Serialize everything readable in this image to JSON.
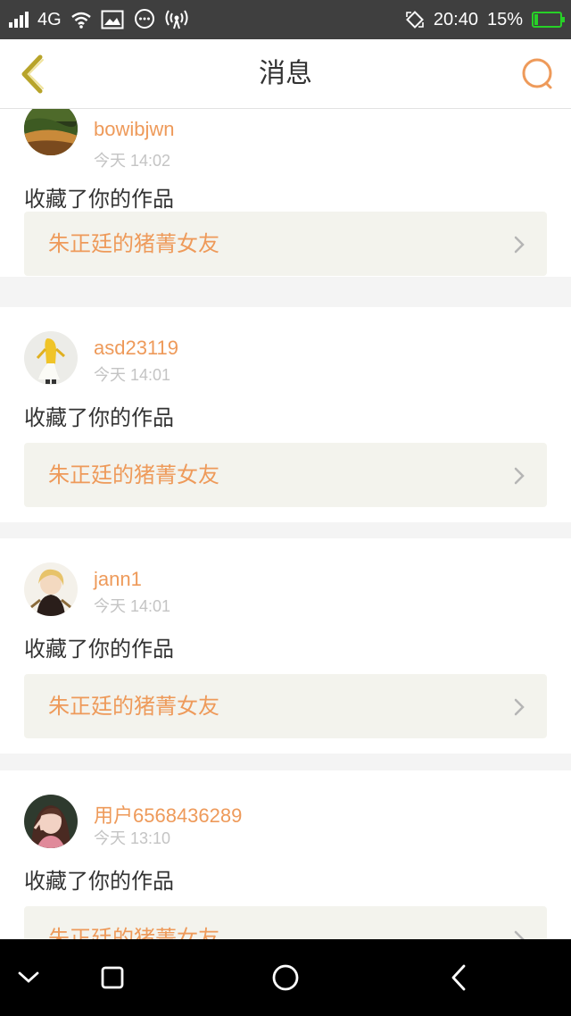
{
  "status_bar": {
    "network": "4G",
    "time": "20:40",
    "battery_percent": "15%",
    "battery_level": 0.15,
    "icons": [
      "signal-icon",
      "wifi-icon",
      "image-icon",
      "chat-bubble-icon",
      "hotspot-icon",
      "rotate-icon",
      "battery-icon"
    ]
  },
  "header": {
    "title": "消息",
    "accent_color": "#ee9a5a",
    "back_icon": "chevron-left-icon",
    "search_icon": "search-icon"
  },
  "messages": [
    {
      "username": "bowibjwn",
      "time": "今天 14:02",
      "action": "收藏了你的作品",
      "work_title": "朱正廷的猪菁女友",
      "avatar": "landscape-avatar"
    },
    {
      "username": "asd23119",
      "time": "今天 14:01",
      "action": "收藏了你的作品",
      "work_title": "朱正廷的猪菁女友",
      "avatar": "banana-avatar"
    },
    {
      "username": "jann1",
      "time": "今天 14:01",
      "action": "收藏了你的作品",
      "work_title": "朱正廷的猪菁女友",
      "avatar": "character-avatar"
    },
    {
      "username": "用户6568436289",
      "time": "今天 13:10",
      "action": "收藏了你的作品",
      "work_title": "朱正廷的猪菁女友",
      "avatar": "person-avatar"
    }
  ],
  "nav_bar": {
    "icons": [
      "chevron-down-icon",
      "square-icon",
      "circle-icon",
      "back-triangle-icon"
    ]
  }
}
